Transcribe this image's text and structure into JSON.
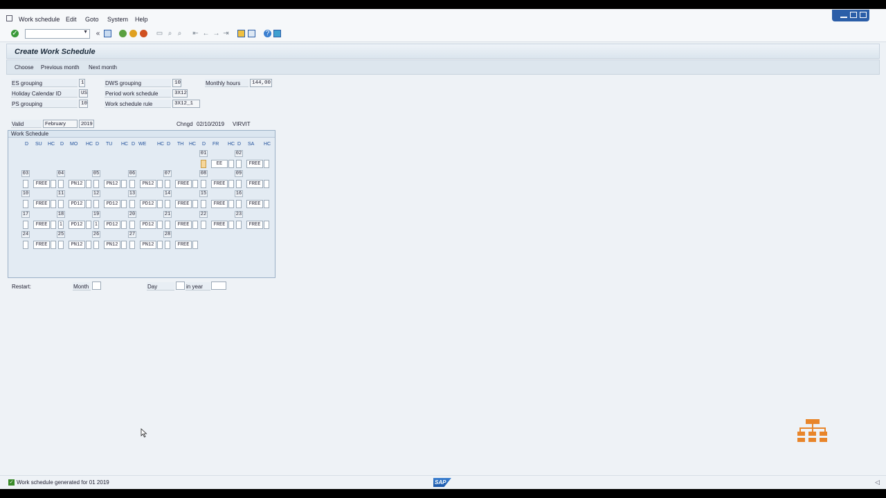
{
  "menu": [
    {
      "label": "Work schedule"
    },
    {
      "label": "Edit"
    },
    {
      "label": "Goto"
    },
    {
      "label": "System"
    },
    {
      "label": "Help"
    }
  ],
  "toolbar": {
    "command_value": "",
    "icons": [
      "check-icon",
      "dropdown-icon",
      "back-double-icon",
      "save-icon",
      "back-icon",
      "exit-icon",
      "cancel-icon",
      "print-icon",
      "find-icon",
      "find-next-icon",
      "first-page-icon",
      "prev-page-icon",
      "next-page-icon",
      "last-page-icon",
      "new-session-icon",
      "shortcut-icon",
      "help-icon",
      "layout-icon"
    ]
  },
  "title": "Create Work Schedule",
  "appbar": {
    "buttons": [
      "Choose",
      "Previous month",
      "Next month"
    ]
  },
  "header_fields": {
    "es_grouping": {
      "label": "ES grouping",
      "value": "1"
    },
    "holiday_calendar": {
      "label": "Holiday Calendar ID",
      "value": "US"
    },
    "ps_grouping": {
      "label": "PS grouping",
      "value": "10"
    },
    "dws_grouping": {
      "label": "DWS grouping",
      "value": "10"
    },
    "period_ws": {
      "label": "Period work schedule",
      "value": "3X12"
    },
    "ws_rule": {
      "label": "Work schedule rule",
      "value": "3X12_1"
    },
    "monthly_hours": {
      "label": "Monthly hours",
      "value": "144,00"
    }
  },
  "valid": {
    "label": "Valid",
    "month": "February",
    "year": "2019"
  },
  "changed": {
    "label": "Chngd",
    "date": "02/10/2019",
    "user": "VIRVIT"
  },
  "work_schedule": {
    "group_title": "Work Schedule",
    "column_headers": [
      "D",
      "SU",
      "HC",
      "D",
      "MO",
      "HC",
      "D",
      "TU",
      "HC",
      "D",
      "WE",
      "HC",
      "D",
      "TH",
      "HC",
      "D",
      "FR",
      "HC",
      "D",
      "SA",
      "HC"
    ],
    "days": [
      {
        "num": "01",
        "d": "",
        "ws": "EE",
        "col": 5,
        "row": 0
      },
      {
        "num": "02",
        "d": "",
        "ws": "FREE",
        "col": 6,
        "row": 0
      },
      {
        "num": "03",
        "d": "",
        "ws": "FREE",
        "col": 0,
        "row": 1
      },
      {
        "num": "04",
        "d": "",
        "ws": "PN12",
        "col": 1,
        "row": 1
      },
      {
        "num": "05",
        "d": "",
        "ws": "PN12",
        "col": 2,
        "row": 1
      },
      {
        "num": "06",
        "d": "",
        "ws": "PN12",
        "col": 3,
        "row": 1
      },
      {
        "num": "07",
        "d": "",
        "ws": "FREE",
        "col": 4,
        "row": 1
      },
      {
        "num": "08",
        "d": "",
        "ws": "FREE",
        "col": 5,
        "row": 1
      },
      {
        "num": "09",
        "d": "",
        "ws": "FREE",
        "col": 6,
        "row": 1
      },
      {
        "num": "10",
        "d": "",
        "ws": "FREE",
        "col": 0,
        "row": 2
      },
      {
        "num": "11",
        "d": "",
        "ws": "PD12",
        "col": 1,
        "row": 2
      },
      {
        "num": "12",
        "d": "",
        "ws": "PD12",
        "col": 2,
        "row": 2
      },
      {
        "num": "13",
        "d": "",
        "ws": "PD12",
        "col": 3,
        "row": 2
      },
      {
        "num": "14",
        "d": "",
        "ws": "FREE",
        "col": 4,
        "row": 2
      },
      {
        "num": "15",
        "d": "",
        "ws": "FREE",
        "col": 5,
        "row": 2
      },
      {
        "num": "16",
        "d": "",
        "ws": "FREE",
        "col": 6,
        "row": 2
      },
      {
        "num": "17",
        "d": "",
        "ws": "FREE",
        "col": 0,
        "row": 3
      },
      {
        "num": "18",
        "d": "1",
        "ws": "PD12",
        "col": 1,
        "row": 3
      },
      {
        "num": "19",
        "d": "1",
        "ws": "PD12",
        "col": 2,
        "row": 3
      },
      {
        "num": "20",
        "d": "",
        "ws": "PD12",
        "col": 3,
        "row": 3
      },
      {
        "num": "21",
        "d": "",
        "ws": "FREE",
        "col": 4,
        "row": 3
      },
      {
        "num": "22",
        "d": "",
        "ws": "FREE",
        "col": 5,
        "row": 3
      },
      {
        "num": "23",
        "d": "",
        "ws": "FREE",
        "col": 6,
        "row": 3
      },
      {
        "num": "24",
        "d": "",
        "ws": "FREE",
        "col": 0,
        "row": 4
      },
      {
        "num": "25",
        "d": "",
        "ws": "PN12",
        "col": 1,
        "row": 4
      },
      {
        "num": "26",
        "d": "",
        "ws": "PN12",
        "col": 2,
        "row": 4
      },
      {
        "num": "27",
        "d": "",
        "ws": "PN12",
        "col": 3,
        "row": 4
      },
      {
        "num": "28",
        "d": "",
        "ws": "FREE",
        "col": 4,
        "row": 4
      }
    ]
  },
  "restart": {
    "label": "Restart:",
    "month_label": "Month",
    "day_label": "Day",
    "year_label": "in year"
  },
  "status": {
    "text": "Work schedule generated for 01 2019"
  },
  "colors": {
    "accent": "#2b5ea8",
    "orgchart": "#e8852a",
    "status_ok": "#3a8a2a"
  }
}
